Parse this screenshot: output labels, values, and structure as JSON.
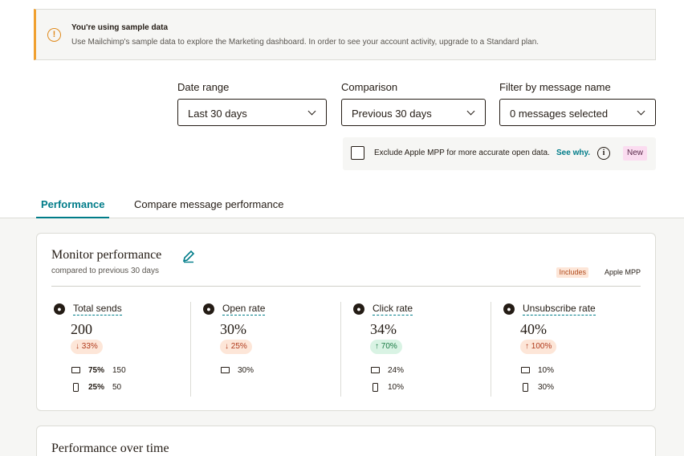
{
  "banner": {
    "icon": "warning-circle-icon",
    "title": "You're using sample data",
    "text": "Use Mailchimp's sample data to explore the Marketing dashboard. In order to see your account activity, upgrade to a Standard plan."
  },
  "filters": {
    "date_range": {
      "label": "Date range",
      "value": "Last 30 days"
    },
    "comparison": {
      "label": "Comparison",
      "value": "Previous 30 days"
    },
    "message_name": {
      "label": "Filter by message name",
      "value": "0 messages selected"
    }
  },
  "mpp": {
    "text": "Exclude Apple MPP for more accurate open data.",
    "link": "See why.",
    "badge": "New"
  },
  "tabs": [
    {
      "label": "Performance",
      "active": true
    },
    {
      "label": "Compare message performance",
      "active": false
    }
  ],
  "monitor": {
    "title": "Monitor performance",
    "subtitle": "compared to previous 30 days",
    "includes": "Includes",
    "apple_mpp": "Apple MPP",
    "metrics": [
      {
        "label": "Total sends",
        "value": "200",
        "change": "33%",
        "direction": "down",
        "rows": [
          {
            "icon": "envelope-icon",
            "pct": "75%",
            "count": "150"
          },
          {
            "icon": "mobile-icon",
            "pct": "25%",
            "count": "50"
          }
        ]
      },
      {
        "label": "Open rate",
        "value": "30%",
        "change": "25%",
        "direction": "down",
        "rows": [
          {
            "icon": "envelope-icon",
            "pct": "",
            "count": "30%"
          }
        ]
      },
      {
        "label": "Click rate",
        "value": "34%",
        "change": "70%",
        "direction": "up",
        "rows": [
          {
            "icon": "envelope-icon",
            "pct": "",
            "count": "24%"
          },
          {
            "icon": "mobile-icon",
            "pct": "",
            "count": "10%"
          }
        ]
      },
      {
        "label": "Unsubscribe rate",
        "value": "40%",
        "change": "100%",
        "direction": "up",
        "rows": [
          {
            "icon": "envelope-icon",
            "pct": "",
            "count": "10%"
          },
          {
            "icon": "mobile-icon",
            "pct": "",
            "count": "30%"
          }
        ]
      }
    ]
  },
  "over_time": {
    "title": "Performance over time"
  },
  "colors": {
    "accent": "#007c89",
    "warning": "#f0a030",
    "down": "#b03a1c",
    "up": "#1a7a44"
  }
}
